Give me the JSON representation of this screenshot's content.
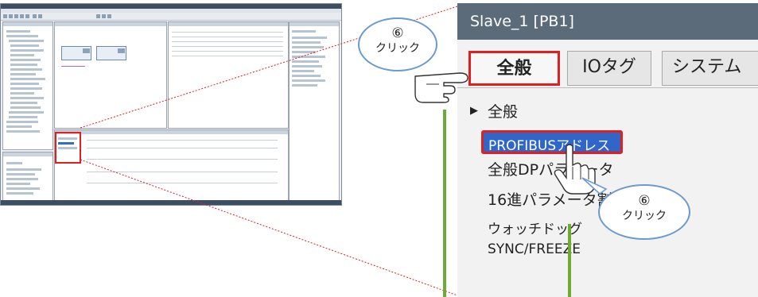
{
  "zoom": {
    "title": "Slave_1 [PB1]",
    "tabs": [
      "全般",
      "IOタグ",
      "システム"
    ],
    "section_header": "全般",
    "items": [
      "PROFIBUSアドレス",
      "全般DPパラメータ",
      "16進パラメータ割り当て",
      "ウォッチドッグ",
      "SYNC/FREEZE"
    ]
  },
  "callouts": [
    {
      "number": "⑥",
      "label": "クリック"
    },
    {
      "number": "⑥",
      "label": "クリック"
    }
  ],
  "colors": {
    "highlight_red": "#e02020",
    "pointer_green": "#6cab35",
    "selection_blue": "#2f66c8",
    "callout_border": "#6a9ad0"
  }
}
